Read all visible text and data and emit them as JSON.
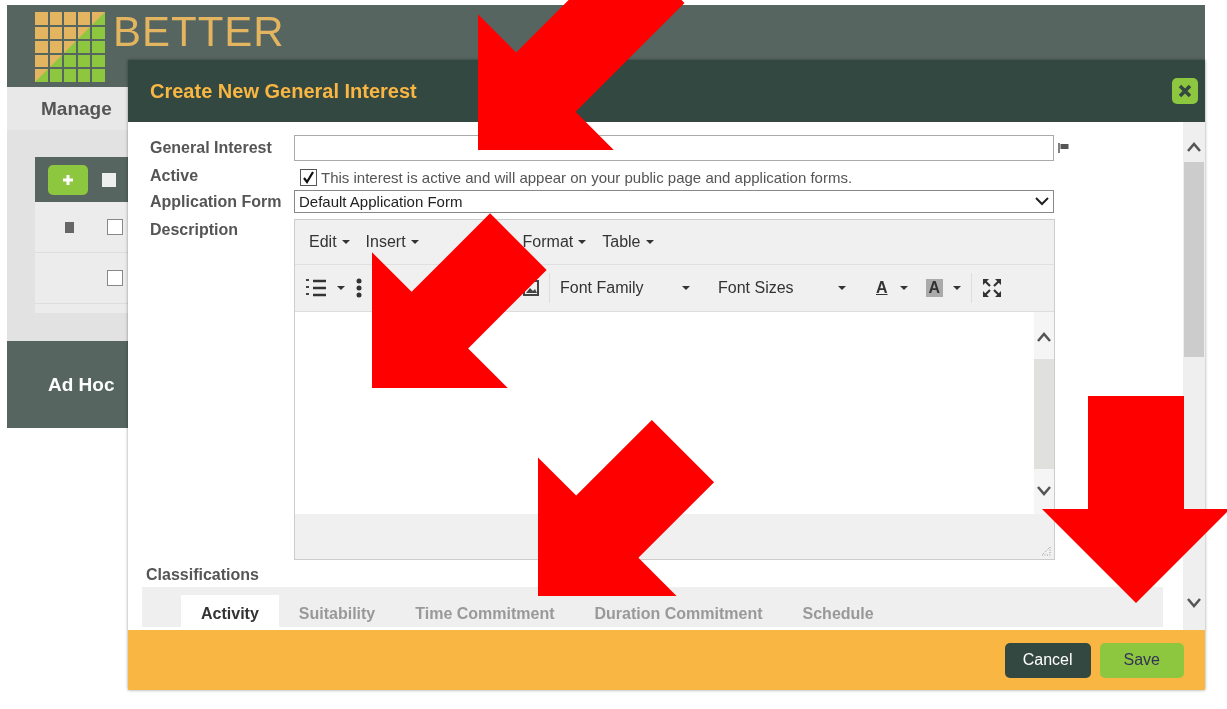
{
  "page": {
    "logo": "BETTER",
    "heading": "Manage",
    "select_all_checked": false,
    "rows": [
      {
        "checked": false
      },
      {
        "checked": false
      }
    ],
    "panel_title": "Ad Hoc"
  },
  "dialog": {
    "title": "Create New General Interest",
    "general_interest": {
      "label": "General Interest"
    },
    "active": {
      "label": "Active",
      "checked": true,
      "text": "This interest is active and will appear on your public page and application forms."
    },
    "application_form": {
      "label": "Application Form",
      "value": "Default Application Form"
    },
    "description": {
      "label": "Description",
      "menus": [
        "Edit",
        "Insert",
        "Format",
        "Table"
      ],
      "font_family": "Font Family",
      "font_sizes": "Font Sizes",
      "text_color": "A",
      "background_color": "A"
    },
    "classifications": {
      "label": "Classifications",
      "tabs": [
        {
          "label": "Activity",
          "selected": true
        },
        {
          "label": "Suitability",
          "selected": false
        },
        {
          "label": "Time Commitment",
          "selected": false
        },
        {
          "label": "Duration Commitment",
          "selected": false
        },
        {
          "label": "Schedule",
          "selected": false
        }
      ]
    },
    "buttons": [
      {
        "label": "Cancel",
        "kind": "secondary"
      },
      {
        "label": "Save",
        "kind": "primary"
      }
    ]
  }
}
